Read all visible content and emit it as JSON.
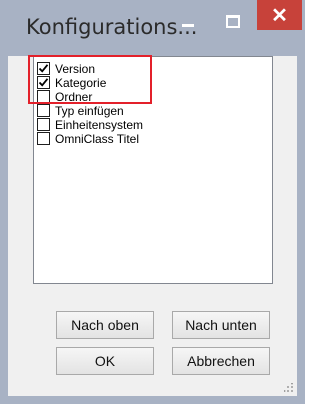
{
  "window": {
    "title": "Konfigurations...",
    "minimize_glyph": "–",
    "close_glyph": "✕"
  },
  "list": {
    "items": [
      {
        "label": "Version",
        "checked": true
      },
      {
        "label": "Kategorie",
        "checked": true
      },
      {
        "label": "Ordner",
        "checked": false
      },
      {
        "label": "Typ einfügen",
        "checked": false
      },
      {
        "label": "Einheitensystem",
        "checked": false
      },
      {
        "label": "OmniClass Titel",
        "checked": false
      }
    ]
  },
  "buttons": {
    "move_up": "Nach oben",
    "move_down": "Nach unten",
    "ok": "OK",
    "cancel": "Abbrechen"
  },
  "colors": {
    "titlebar": "#a8b2c4",
    "close": "#c7423a",
    "highlight_box": "#e3202a"
  }
}
